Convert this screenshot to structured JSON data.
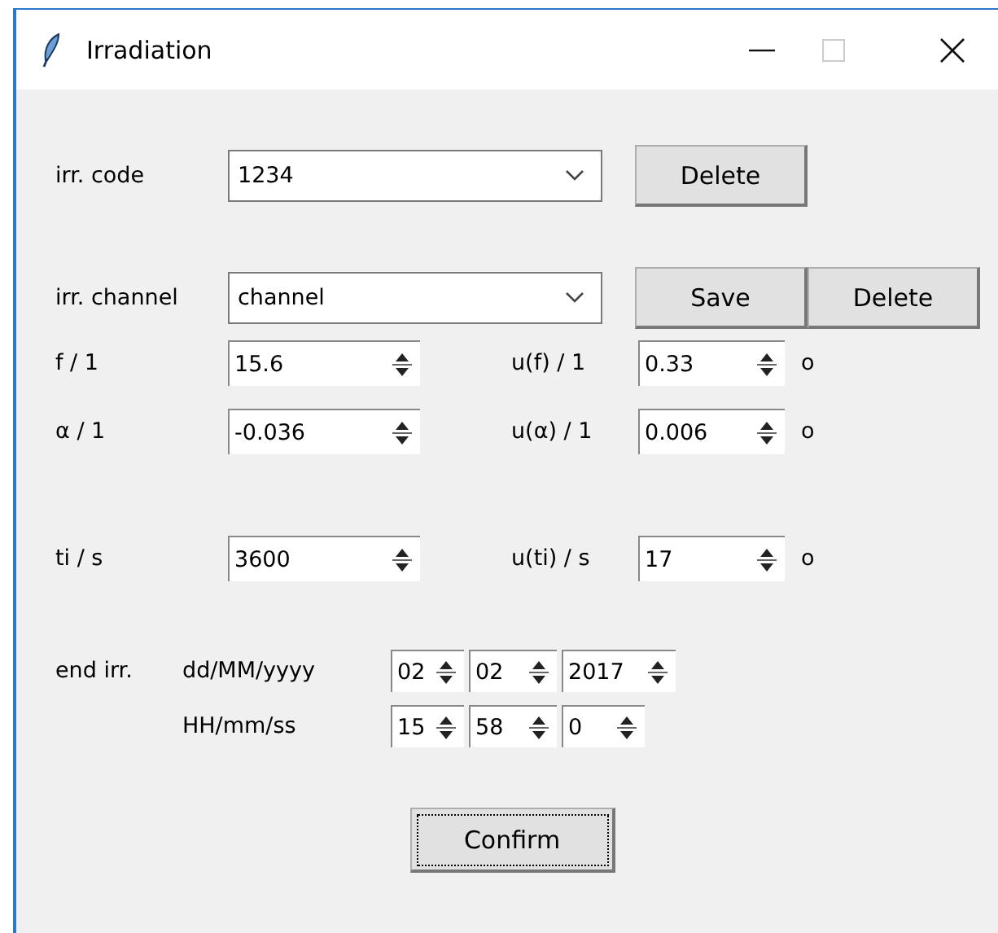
{
  "window": {
    "title": "Irradiation"
  },
  "code": {
    "label": "irr. code",
    "value": "1234",
    "buttons": [
      "Delete"
    ]
  },
  "channel": {
    "label": "irr. channel",
    "value": "channel",
    "buttons": [
      "Save",
      "Delete"
    ]
  },
  "params": [
    {
      "label": "f / 1",
      "value": "15.6",
      "u_label": "u(f) / 1",
      "u_value": "0.33",
      "mark": "o"
    },
    {
      "label": "α / 1",
      "value": "-0.036",
      "u_label": "u(α) / 1",
      "u_value": "0.006",
      "mark": "o"
    }
  ],
  "time": {
    "label": "ti / s",
    "value": "3600",
    "u_label": "u(ti) / s",
    "u_value": "17",
    "mark": "o"
  },
  "end_irr": {
    "label": "end irr.",
    "date_label": "dd/MM/yyyy",
    "date": [
      "02",
      "02",
      "2017"
    ],
    "time_label": "HH/mm/ss",
    "time": [
      "15",
      "58",
      "0"
    ]
  },
  "confirm": "Confirm"
}
